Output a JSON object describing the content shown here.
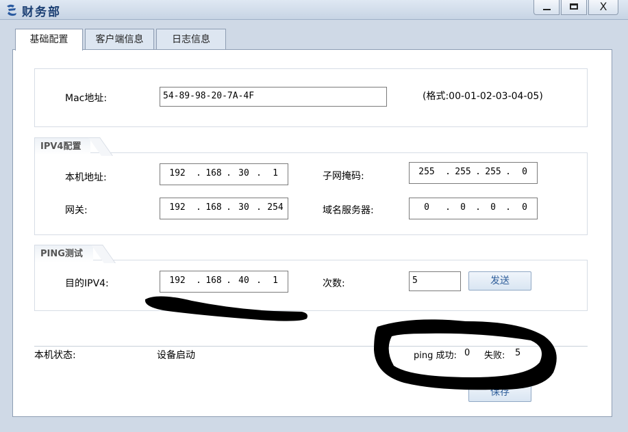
{
  "window": {
    "title": "财务部",
    "minimize": "_",
    "maximize": "□",
    "close": "X"
  },
  "tabs": [
    {
      "label": "基础配置",
      "active": true
    },
    {
      "label": "客户端信息",
      "active": false
    },
    {
      "label": "日志信息",
      "active": false
    }
  ],
  "mac": {
    "label": "Mac地址:",
    "value": "54-89-98-20-7A-4F",
    "hint": "(格式:00-01-02-03-04-05)"
  },
  "ipv4": {
    "section_title": "IPV4配置",
    "local_label": "本机地址:",
    "local": [
      "192",
      "168",
      "30",
      "1"
    ],
    "mask_label": "子网掩码:",
    "mask": [
      "255",
      "255",
      "255",
      "0"
    ],
    "gateway_label": "网关:",
    "gateway": [
      "192",
      "168",
      "30",
      "254"
    ],
    "dns_label": "域名服务器:",
    "dns": [
      "0",
      "0",
      "0",
      "0"
    ]
  },
  "ping": {
    "section_title": "PING测试",
    "target_label": "目的IPV4:",
    "target": [
      "192",
      "168",
      "40",
      "1"
    ],
    "count_label": "次数:",
    "count": "5",
    "send_label": "发送"
  },
  "status": {
    "label": "本机状态:",
    "value": "设备启动",
    "ping_success_label": "ping 成功:",
    "ping_success": "0",
    "ping_fail_label": "失败:",
    "ping_fail": "5"
  },
  "save_label": "保存",
  "colors": {
    "title_text": "#1b3f73",
    "button_text": "#2f5e9a",
    "window_bg": "#cfd9e6"
  }
}
